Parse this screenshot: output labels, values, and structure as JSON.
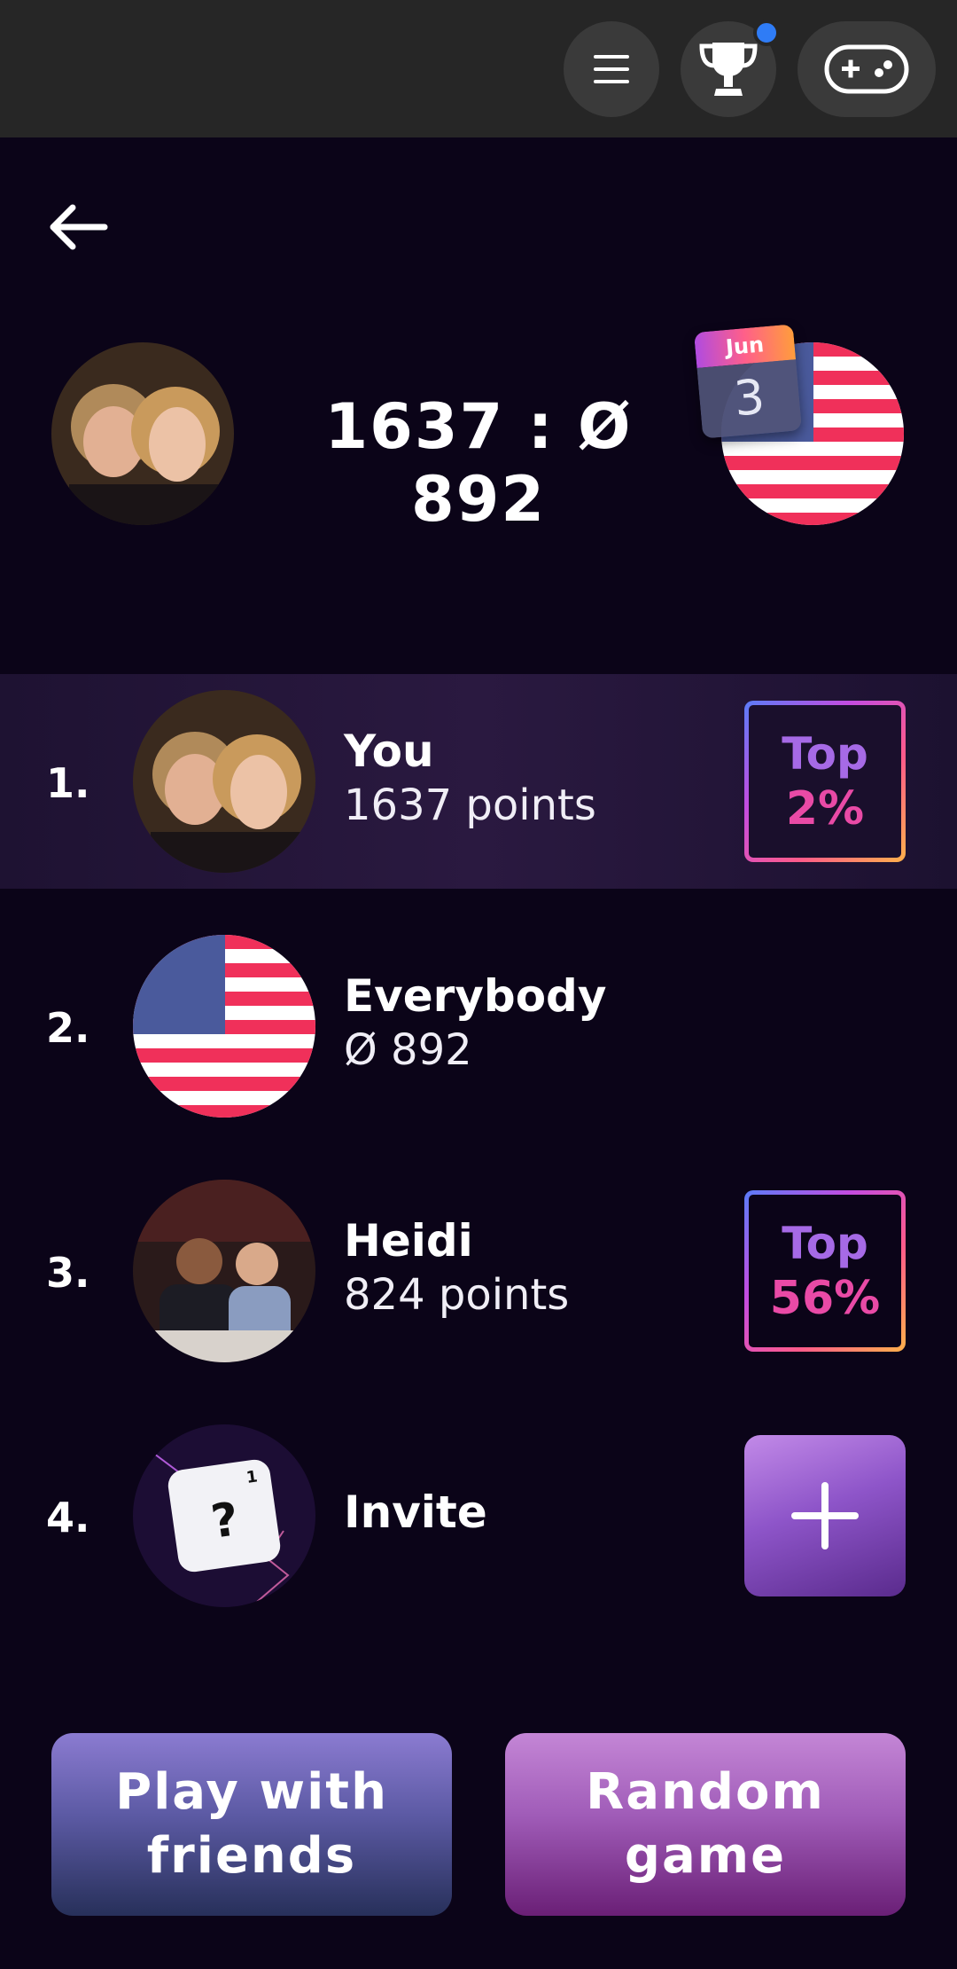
{
  "topbar": {
    "menu_icon": "hamburger-menu-icon",
    "trophy_icon": "trophy-icon",
    "gamepad_icon": "gamepad-icon",
    "notification_color": "#2f7cf6"
  },
  "header": {
    "score": "1637 : Ø 892",
    "calendar_month": "Jun",
    "calendar_day": "3"
  },
  "leaderboard": [
    {
      "rank": "1.",
      "name": "You",
      "sub": "1637 points",
      "badge_line1": "Top",
      "badge_line2": "2%"
    },
    {
      "rank": "2.",
      "name": "Everybody",
      "sub": "Ø 892"
    },
    {
      "rank": "3.",
      "name": "Heidi",
      "sub": "824 points",
      "badge_line1": "Top",
      "badge_line2": "56%"
    },
    {
      "rank": "4.",
      "name": "Invite",
      "tile_letter": "?",
      "tile_value": "1"
    }
  ],
  "buttons": {
    "play_with_friends": "Play with friends",
    "random_game": "Random game"
  },
  "colors": {
    "background": "#0b0418",
    "topbar": "#262626",
    "badge_top": "#a66ae6",
    "badge_pct": "#e94aa6"
  }
}
